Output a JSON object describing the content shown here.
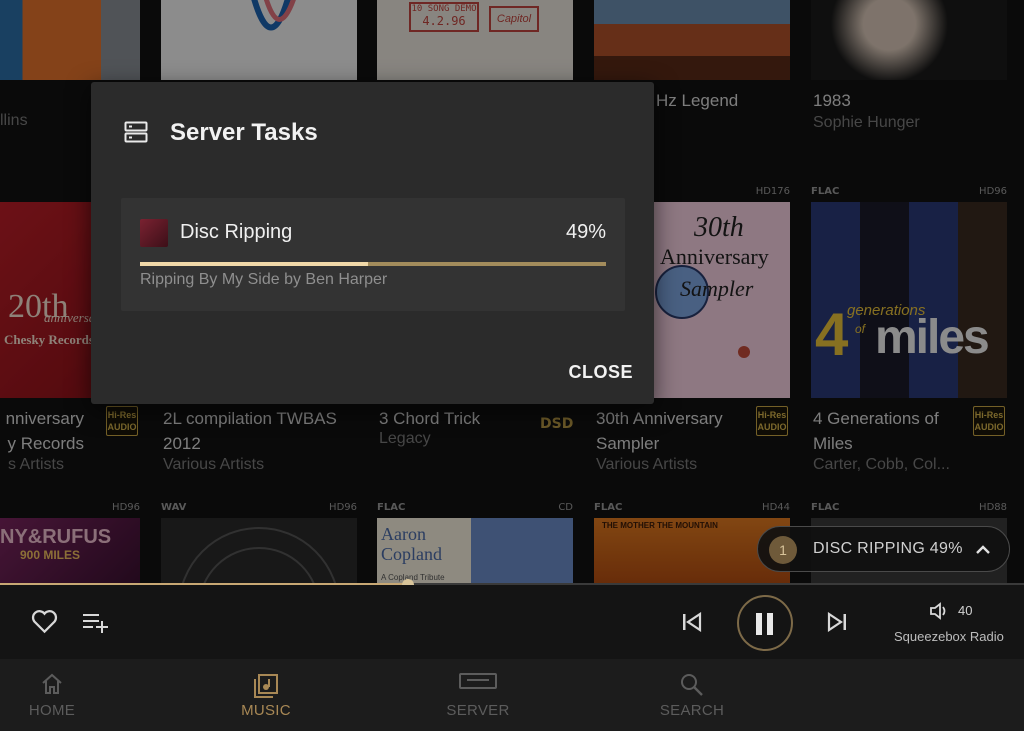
{
  "albums_row1": [
    {
      "title": "",
      "artist": "llins"
    },
    {
      "title": "",
      "artist": ""
    },
    {
      "title": "",
      "artist": ""
    },
    {
      "title": "Hz Legend",
      "artist": ""
    },
    {
      "title": "1983",
      "artist": "Sophie Hunger"
    }
  ],
  "albums_row2": [
    {
      "quality": "",
      "format": "",
      "title_lines": [
        "nniversary",
        "y Records"
      ],
      "artist": "s Artists",
      "badge": "hires"
    },
    {
      "quality": "",
      "format": "",
      "title_lines": [
        "2L compilation TWBAS",
        "2012"
      ],
      "artist": "Various Artists",
      "badge": ""
    },
    {
      "quality": "",
      "format": "",
      "title_lines": [
        "3 Chord Trick"
      ],
      "artist": "Legacy",
      "badge": "dsd"
    },
    {
      "quality": "HD176",
      "format": "",
      "title_lines": [
        "30th Anniversary",
        "Sampler"
      ],
      "artist": "Various Artists",
      "badge": "hires"
    },
    {
      "quality": "HD96",
      "format": "FLAC",
      "title_lines": [
        "4 Generations of",
        "Miles"
      ],
      "artist": "Carter, Cobb, Col...",
      "badge": "hires"
    }
  ],
  "albums_row3": [
    {
      "format": "",
      "quality": "HD96"
    },
    {
      "format": "WAV",
      "quality": "HD96"
    },
    {
      "format": "FLAC",
      "quality": "CD"
    },
    {
      "format": "FLAC",
      "quality": "HD44"
    },
    {
      "format": "FLAC",
      "quality": "HD88"
    }
  ],
  "cover_text": {
    "hires_badge": "Hi-Res AUDIO",
    "dsd_badge": "DSD",
    "row1_c3a": "10 SONG DEMO",
    "row1_c3b": "4.2.96",
    "row1_c3c": "Capitol",
    "row2_c1a": "20th",
    "row2_c1b": "anniversary",
    "row2_c1c": "Chesky Records",
    "row2_c4a": "30th",
    "row2_c4b": "Anniversary",
    "row2_c4c": "Sampler",
    "row2_c5a": "4",
    "row2_c5b": "generations",
    "row2_c5c": "of",
    "row2_c5d": "miles",
    "row3_c1": "NY&RUFUS",
    "row3_c1b": "900 MILES",
    "row3_c3a": "Aaron",
    "row3_c3b": "Copland",
    "row3_c3c": "A Copland Tribute",
    "row3_c4": "THE MOTHER THE MOUNTAIN"
  },
  "dialog": {
    "title": "Server Tasks",
    "task": {
      "name": "Disc Ripping",
      "percent_label": "49%",
      "progress": 0.49,
      "detail": "Ripping By My Side by Ben Harper"
    },
    "close_label": "CLOSE"
  },
  "ripping_pill": {
    "count": "1",
    "label": "DISC RIPPING 49%"
  },
  "player": {
    "seek_progress": 0.4,
    "volume": "40",
    "device": "Squeezebox Radio"
  },
  "nav": {
    "items": [
      {
        "label": "HOME",
        "icon": "home-icon"
      },
      {
        "label": "MUSIC",
        "icon": "music-icon"
      },
      {
        "label": "SERVER",
        "icon": "server-icon"
      },
      {
        "label": "SEARCH",
        "icon": "search-icon"
      }
    ],
    "active": "MUSIC"
  },
  "colors": {
    "accent": "#a88855",
    "hires_gold": "#c9a544",
    "dialog_bg": "#2b2b2b",
    "nav_bg": "#1c1c1c"
  }
}
